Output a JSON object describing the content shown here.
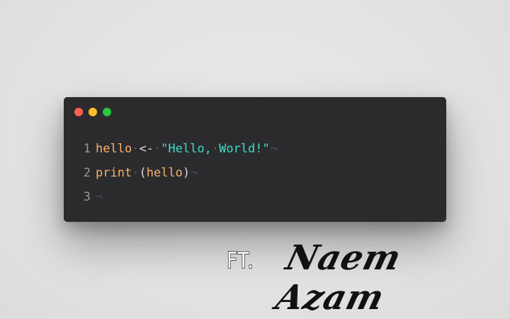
{
  "window": {
    "controls": [
      {
        "name": "close",
        "color": "#ff5f56"
      },
      {
        "name": "minimize",
        "color": "#ffbd2e"
      },
      {
        "name": "maximize",
        "color": "#27c93f"
      }
    ]
  },
  "code": {
    "lines": [
      {
        "number": "1",
        "tokens": [
          {
            "text": "hello",
            "kind": "fn"
          },
          {
            "text": "·",
            "kind": "ws"
          },
          {
            "text": "<-",
            "kind": "op"
          },
          {
            "text": "·",
            "kind": "ws"
          },
          {
            "text": "\"Hello,",
            "kind": "str"
          },
          {
            "text": "·",
            "kind": "ws"
          },
          {
            "text": "World!\"",
            "kind": "str"
          },
          {
            "text": "¬",
            "kind": "eol"
          }
        ]
      },
      {
        "number": "2",
        "tokens": [
          {
            "text": "print",
            "kind": "fn"
          },
          {
            "text": "·",
            "kind": "ws"
          },
          {
            "text": "(",
            "kind": "op"
          },
          {
            "text": "hello",
            "kind": "fn"
          },
          {
            "text": ")",
            "kind": "op"
          },
          {
            "text": "¬",
            "kind": "eol"
          }
        ]
      },
      {
        "number": "3",
        "tokens": [
          {
            "text": "¬",
            "kind": "eol"
          }
        ]
      }
    ]
  },
  "credit": {
    "prefix": "FT.",
    "name": "Naem Azam"
  }
}
